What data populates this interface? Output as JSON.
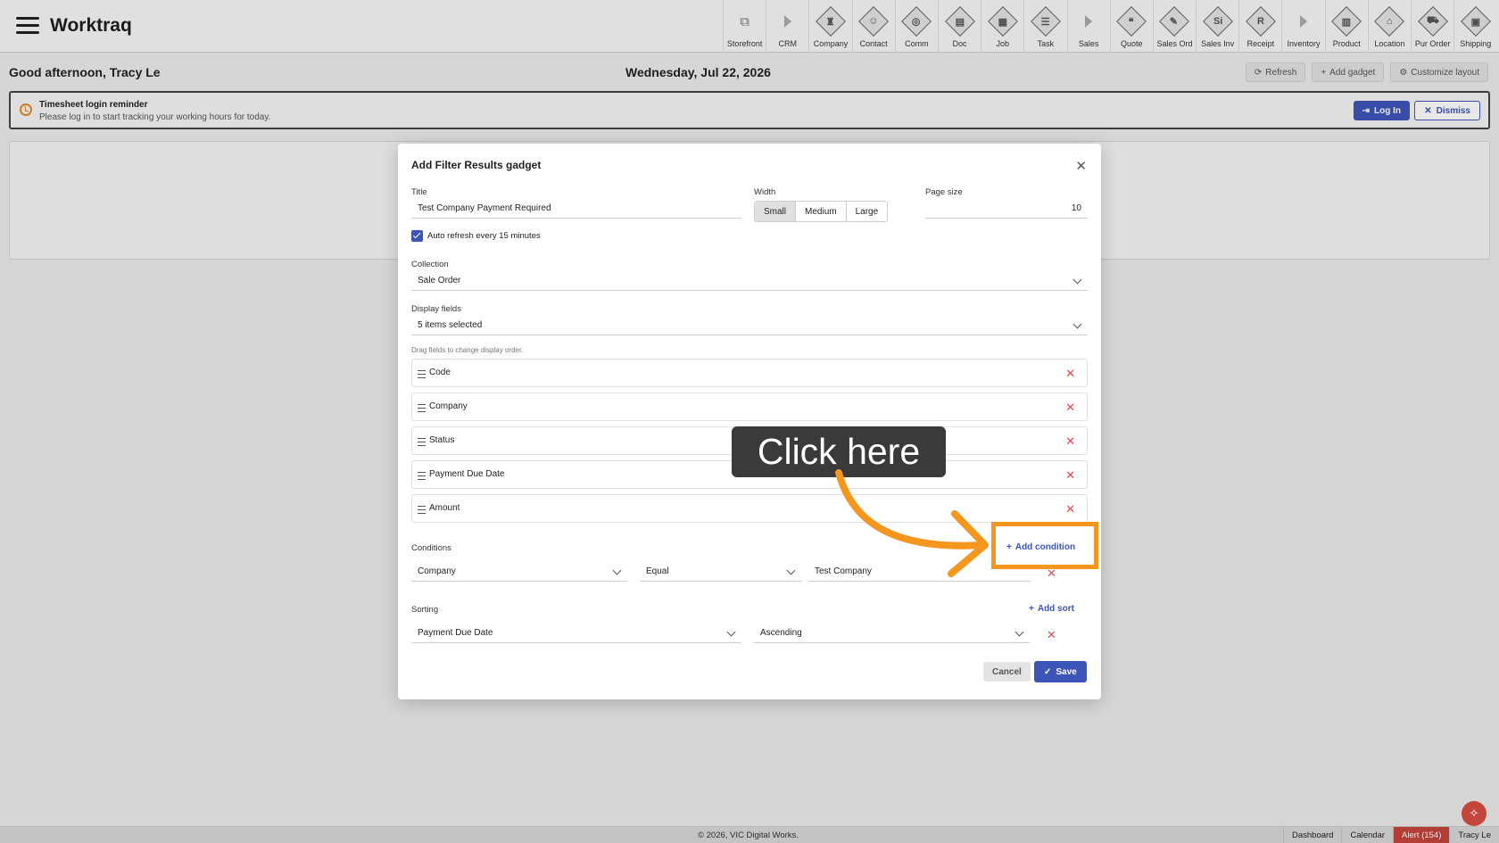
{
  "header": {
    "app_name": "Worktraq",
    "modules": [
      {
        "label": "Storefront",
        "icon": "external-link-icon"
      },
      {
        "label": "CRM",
        "icon": "play-arrow-icon"
      },
      {
        "label": "Company",
        "icon": "company-icon"
      },
      {
        "label": "Contact",
        "icon": "contact-icon"
      },
      {
        "label": "Comm",
        "icon": "comm-icon"
      },
      {
        "label": "Doc",
        "icon": "document-icon"
      },
      {
        "label": "Job",
        "icon": "job-icon"
      },
      {
        "label": "Task",
        "icon": "task-icon"
      },
      {
        "label": "Sales",
        "icon": "play-arrow-icon"
      },
      {
        "label": "Quote",
        "icon": "quote-icon"
      },
      {
        "label": "Sales Ord",
        "icon": "sales-order-icon"
      },
      {
        "label": "Sales Inv",
        "icon": "sales-invoice-icon",
        "glyph": "Si"
      },
      {
        "label": "Receipt",
        "icon": "receipt-icon",
        "glyph": "R"
      },
      {
        "label": "Inventory",
        "icon": "play-arrow-icon"
      },
      {
        "label": "Product",
        "icon": "product-icon"
      },
      {
        "label": "Location",
        "icon": "location-icon"
      },
      {
        "label": "Pur Order",
        "icon": "purchase-order-icon"
      },
      {
        "label": "Shipping",
        "icon": "shipping-icon"
      }
    ]
  },
  "dashboard": {
    "greeting": "Good afternoon, Tracy Le",
    "date": "Wednesday, Jul 22, 2026",
    "refresh_label": "Refresh",
    "add_gadget_label": "Add gadget",
    "customize_label": "Customize layout"
  },
  "reminder": {
    "title": "Timesheet login reminder",
    "text": "Please log in to start tracking your working hours for today.",
    "login_label": "Log In",
    "dismiss_label": "Dismiss"
  },
  "modal": {
    "title": "Add Filter Results gadget",
    "title_label": "Title",
    "title_value": "Test Company Payment Required",
    "width_label": "Width",
    "width_options": [
      "Small",
      "Medium",
      "Large"
    ],
    "width_selected": "Small",
    "page_size_label": "Page size",
    "page_size_value": "10",
    "auto_refresh_label": "Auto refresh every 15 minutes",
    "auto_refresh_checked": true,
    "collection_label": "Collection",
    "collection_value": "Sale Order",
    "display_fields_label": "Display fields",
    "display_fields_value": "5 items selected",
    "drag_hint": "Drag fields to change display order.",
    "fields": [
      "Code",
      "Company",
      "Status",
      "Payment Due Date",
      "Amount"
    ],
    "conditions_label": "Conditions",
    "add_condition_label": "Add condition",
    "condition": {
      "field": "Company",
      "operator": "Equal",
      "value": "Test Company"
    },
    "sorting_label": "Sorting",
    "add_sort_label": "Add sort",
    "sort": {
      "field": "Payment Due Date",
      "direction": "Ascending"
    },
    "cancel_label": "Cancel",
    "save_label": "Save"
  },
  "annotation": {
    "callout_text": "Click here",
    "accent_color": "#f5961e"
  },
  "footer": {
    "copyright": "© 2026, VIC Digital Works.",
    "links": [
      "Dashboard",
      "Calendar",
      "Alert (154)",
      "Tracy Le"
    ]
  },
  "colors": {
    "primary": "#3d55b8",
    "danger": "#e04a56",
    "alert": "#c4453c"
  }
}
